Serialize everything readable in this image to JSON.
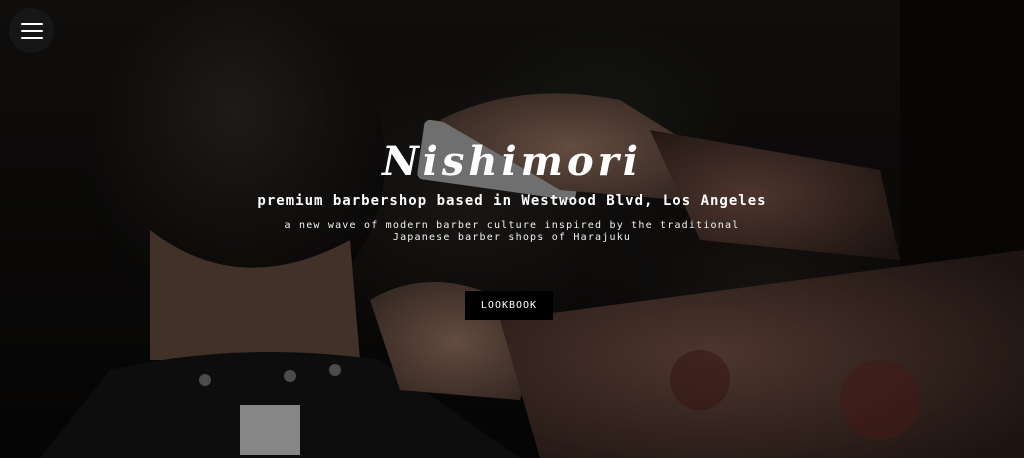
{
  "nav": {
    "menu_icon": "hamburger-menu-icon"
  },
  "hero": {
    "title": "Nishimori",
    "subtitle": "premium barbershop based in Westwood Blvd, Los Angeles",
    "tagline": "a new wave of modern barber culture inspired by the traditional Japanese barber shops of Harajuku",
    "cta_label": "LOOKBOOK"
  },
  "colors": {
    "text": "#ffffff",
    "button_bg": "#000000",
    "menu_bg": "#191919"
  }
}
